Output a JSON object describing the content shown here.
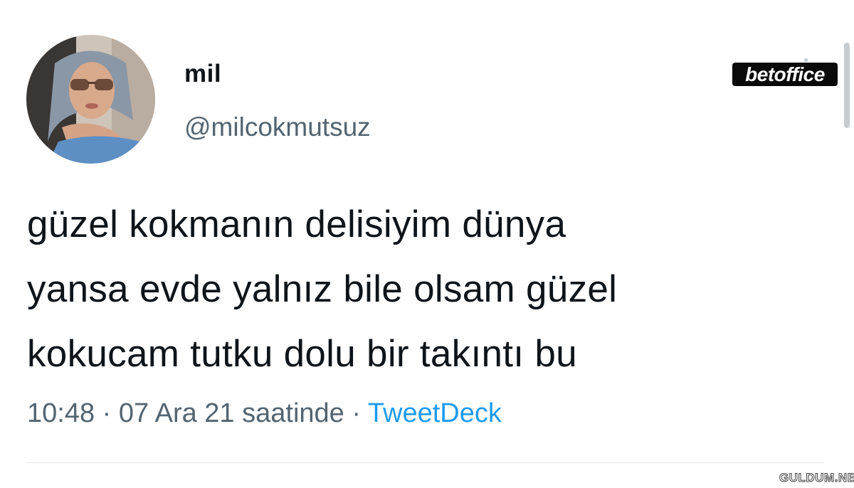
{
  "tweet": {
    "display_name": "mil",
    "handle": "@milcokmutsuz",
    "text_lines": [
      "güzel kokmanın delisiyim dünya",
      "yansa evde yalnız bile olsam güzel",
      "kokucam tutku dolu bir takıntı bu"
    ],
    "time": "10:48",
    "separator": "·",
    "date": "07 Ara 21 saatinde",
    "source": "TweetDeck",
    "source_color": "#1d9bf0"
  },
  "overlays": {
    "brand_badge": "betoffice",
    "watermark": "GULDUM.NET"
  },
  "icons": {
    "avatar": "profile-photo-woman-sunglasses"
  }
}
